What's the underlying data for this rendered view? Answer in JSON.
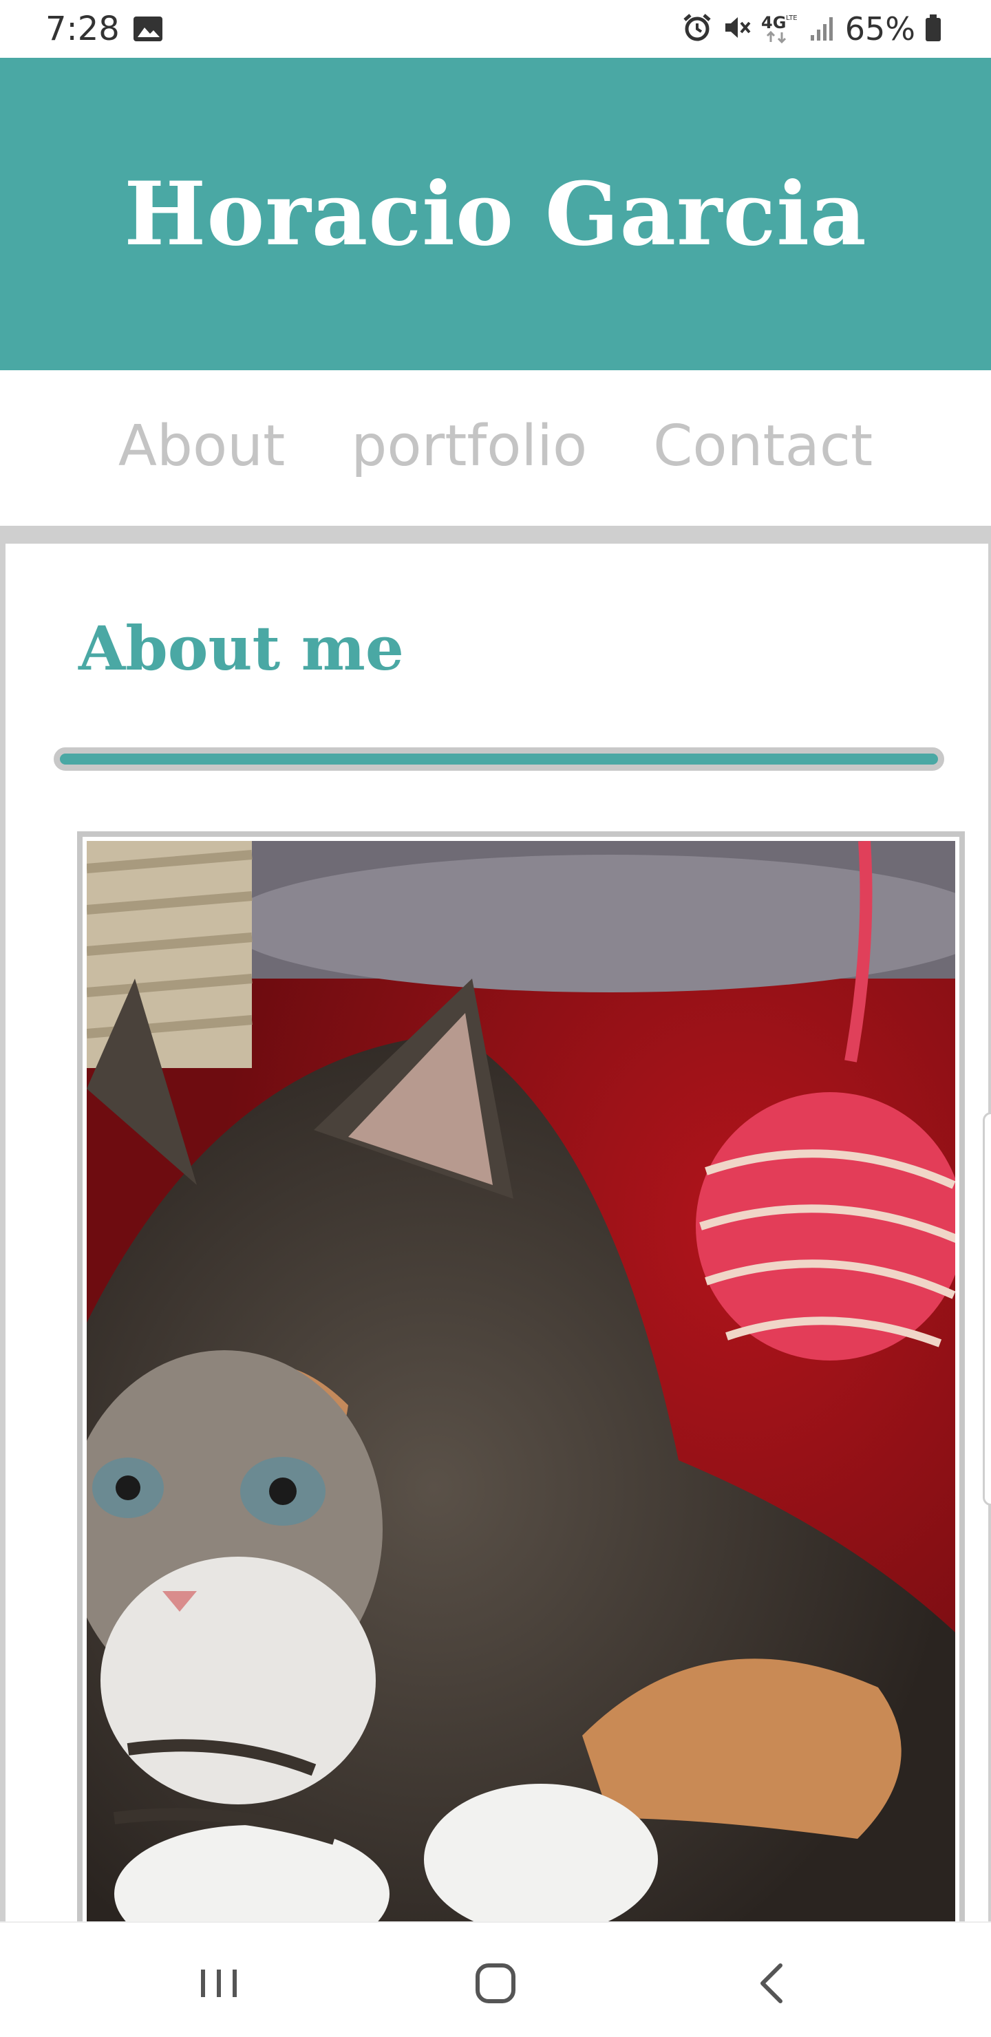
{
  "status_bar": {
    "time": "7:28",
    "battery": "65%",
    "icons": [
      "gallery-icon",
      "alarm-icon",
      "mute-icon",
      "4g-lte-icon",
      "signal-icon",
      "battery-icon"
    ]
  },
  "header": {
    "title": "Horacio Garcia"
  },
  "nav": {
    "items": [
      {
        "label": "About"
      },
      {
        "label": "portfolio"
      },
      {
        "label": "Contact"
      }
    ]
  },
  "about_section": {
    "heading": "About me",
    "image_alt": "Kitten photo"
  },
  "system_nav": {
    "buttons": [
      "recents-icon",
      "home-icon",
      "back-icon"
    ]
  },
  "colors": {
    "brand": "#4aa8a4",
    "nav_text": "#c4c4c4",
    "frame_gray": "#cfcfcf"
  }
}
